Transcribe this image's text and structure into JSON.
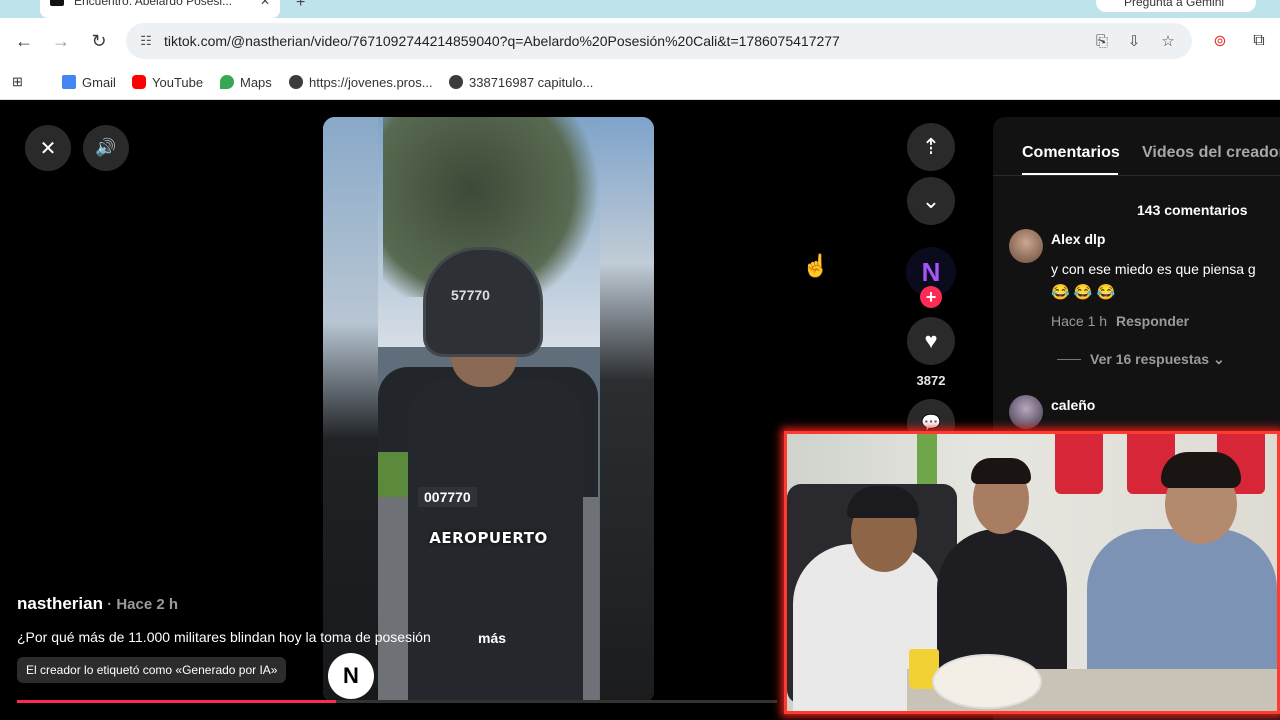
{
  "browser": {
    "tab_title": "Encuentro: Abelardo Posesi...",
    "gemini_label": "Pregunta a Gemini",
    "url": "tiktok.com/@nastherian/video/7671092744214859040?q=Abelardo%20Posesión%20Cali&t=1786075417277",
    "bookmarks": [
      {
        "label": "Gmail",
        "color": "#4285f4"
      },
      {
        "label": "YouTube",
        "color": "#ff0000"
      },
      {
        "label": "Maps",
        "color": "#34a853"
      },
      {
        "label": "https://jovenes.pros...",
        "color": "#3c3c3c"
      },
      {
        "label": "338716987 capitulo...",
        "color": "#3c3c3c"
      }
    ]
  },
  "video": {
    "caption": "AEROPUERTO",
    "vest_number": "007770",
    "helmet_number": "57770",
    "watermark": "N"
  },
  "post": {
    "author": "nastherian",
    "time": " · Hace 2 h",
    "description": "¿Por qué más de 11.000 militares blindan hoy la toma de posesión",
    "more_label": "más",
    "ai_tag": "El creador lo etiquetó como «Generado por IA»",
    "progress": 0.42
  },
  "actions": {
    "likes": "3872"
  },
  "comments_panel": {
    "tab_comments": "Comentarios",
    "tab_videos": "Videos del creador",
    "count": "143 comentarios",
    "comments": [
      {
        "name": "Alex dlp",
        "text": "y con ese miedo es que piensa g",
        "emoji": "😂 😂 😂",
        "time": "Hace 1 h",
        "reply": "Responder",
        "replies": "Ver 16 respuestas"
      },
      {
        "name": "caleño"
      }
    ]
  },
  "colors": {
    "accent": "#fe2c55",
    "cam_border": "#ff3b30"
  }
}
